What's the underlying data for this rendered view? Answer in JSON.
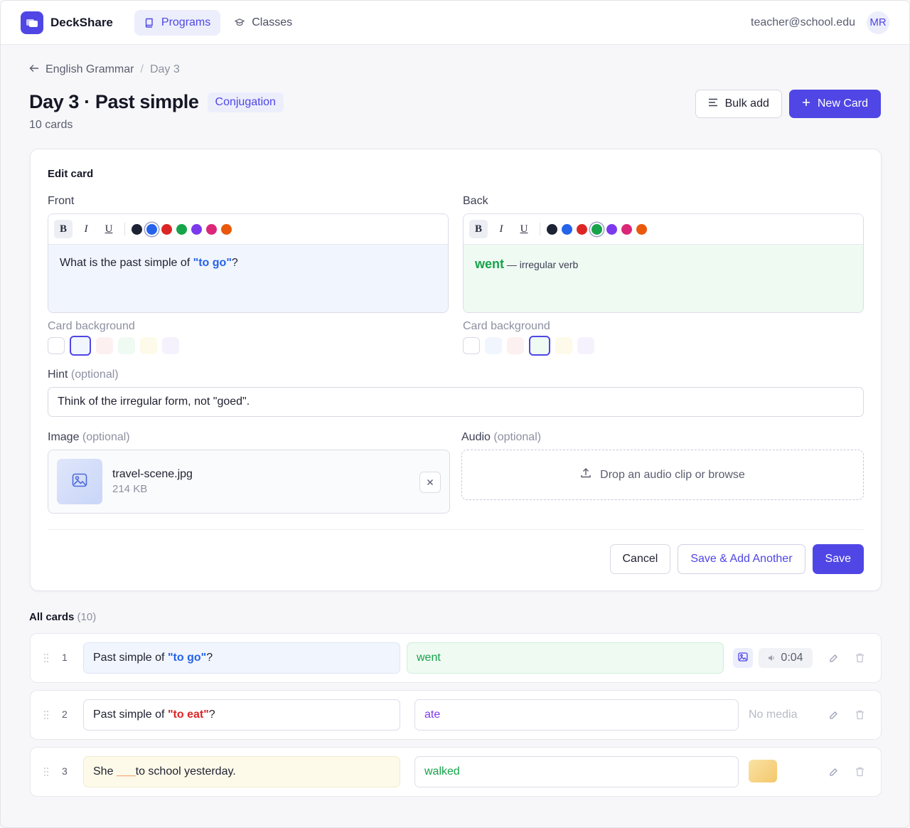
{
  "app": {
    "name": "DeckShare"
  },
  "nav": {
    "programs": "Programs",
    "classes": "Classes"
  },
  "user": {
    "email": "teacher@school.edu",
    "initials": "MR"
  },
  "breadcrumb": {
    "parent": "English Grammar",
    "separator": "/",
    "current": "Day 3"
  },
  "page": {
    "title": "Day 3 · Past simple",
    "tag": "Conjugation",
    "count": "10 cards"
  },
  "actions": {
    "bulk_add": "Bulk add",
    "new_card": "New Card"
  },
  "edit_card": {
    "title": "Edit card",
    "front": {
      "label": "Front",
      "text_before": "What is the past simple of ",
      "text_highlight": "\"to go\"",
      "text_after": "?",
      "background_label": "Card background"
    },
    "back": {
      "label": "Back",
      "text_main": "went",
      "text_note": " — irregular verb",
      "background_label": "Card background"
    },
    "text_colors": [
      "#1e2235",
      "#2563eb",
      "#dc2626",
      "#16a34a",
      "#7c3aed",
      "#db2777",
      "#ea580c"
    ],
    "background_colors": [
      "#ffffff",
      "#f1f5fd",
      "#fdf0f0",
      "#effaf3",
      "#fdfae9",
      "#f6f2fd"
    ],
    "hint": {
      "label": "Hint",
      "optional": "(optional)",
      "value": "Think of the irregular form, not \"goed\"."
    },
    "image": {
      "label": "Image",
      "optional": "(optional)",
      "file_name": "travel-scene.jpg",
      "file_size": "214 KB"
    },
    "audio": {
      "label": "Audio",
      "optional": "(optional)",
      "drop_text": "Drop an audio clip or browse"
    },
    "buttons": {
      "cancel": "Cancel",
      "save_add": "Save & Add Another",
      "save": "Save"
    }
  },
  "list": {
    "title": "All cards",
    "count": "(10)",
    "rows": [
      {
        "num": "1",
        "front_before": "Past simple of ",
        "front_highlight": "\"to go\"",
        "front_after": "?",
        "back": "went",
        "audio_duration": "0:04"
      },
      {
        "num": "2",
        "front_before": "Past simple of ",
        "front_highlight": "\"to eat\"",
        "front_after": "?",
        "back": "ate",
        "media": "No media"
      },
      {
        "num": "3",
        "front_before": "She ",
        "front_highlight": "___",
        "front_after": " to school yesterday.",
        "back": "walked"
      }
    ]
  }
}
